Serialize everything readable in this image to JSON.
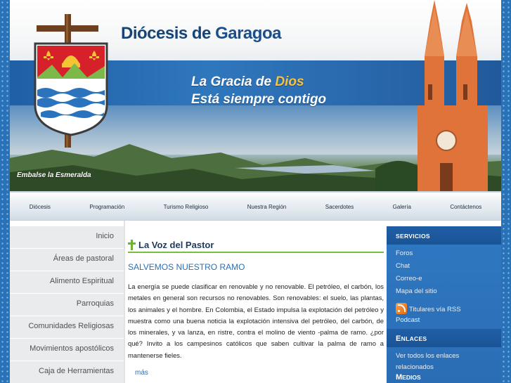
{
  "header": {
    "title_part1": "Diócesis de",
    "title_part2": "Garagoa",
    "tagline_line1_a": "La Gracia de",
    "tagline_line1_b": "Dios",
    "tagline_line2": "Está siempre contigo",
    "photo_caption": "Embalse la Esmeralda"
  },
  "nav": {
    "items": [
      "Diócesis",
      "Programación",
      "Turismo Religioso",
      "Nuestra Región",
      "Sacerdotes",
      "Galería",
      "Contáctenos"
    ]
  },
  "left_menu": {
    "items": [
      "Inicio",
      "Áreas de pastoral",
      "Alimento Espiritual",
      "Parroquias",
      "Comunidades Religiosas",
      "Movimientos apostólicos",
      "Caja de Herramientas"
    ]
  },
  "article": {
    "section_title": "La Voz del Pastor",
    "headline": "SALVEMOS NUESTRO RAMO",
    "body": "La energía se puede clasificar en renovable y no renovable. El petróleo, el carbón, los metales en general son recursos no renovables. Son renovables: el suelo, las plantas, los animales y el hombre. En Colombia, el Estado impulsa la explotación del petróleo y muestra como una buena noticia la explotación intensiva del petróleo, del carbón, de los minerales, y va lanza, en ristre, contra el molino de viento -palma de ramo. ¿por qué? Invito a los campesinos católicos que saben cultivar la palma de ramo a mantenerse fieles.",
    "more_label": "más"
  },
  "sidebar": {
    "services_title": "Servicios",
    "services": [
      "Foros",
      "Chat",
      "Correo-e",
      "Mapa del sitio"
    ],
    "rss_label": "Titulares vía RSS",
    "podcast_label": "Podcast",
    "links_title_cap": "E",
    "links_title_rest": "NLACES",
    "links_all": "Ver todos los enlaces relacionados",
    "media_title_cap": "M",
    "media_title_rest": "EDIOS"
  },
  "colors": {
    "brand_blue": "#1b4e8a",
    "accent_green": "#7bbd43",
    "link_blue": "#2c6fb5",
    "sidebar_blue": "#2a6db5"
  }
}
